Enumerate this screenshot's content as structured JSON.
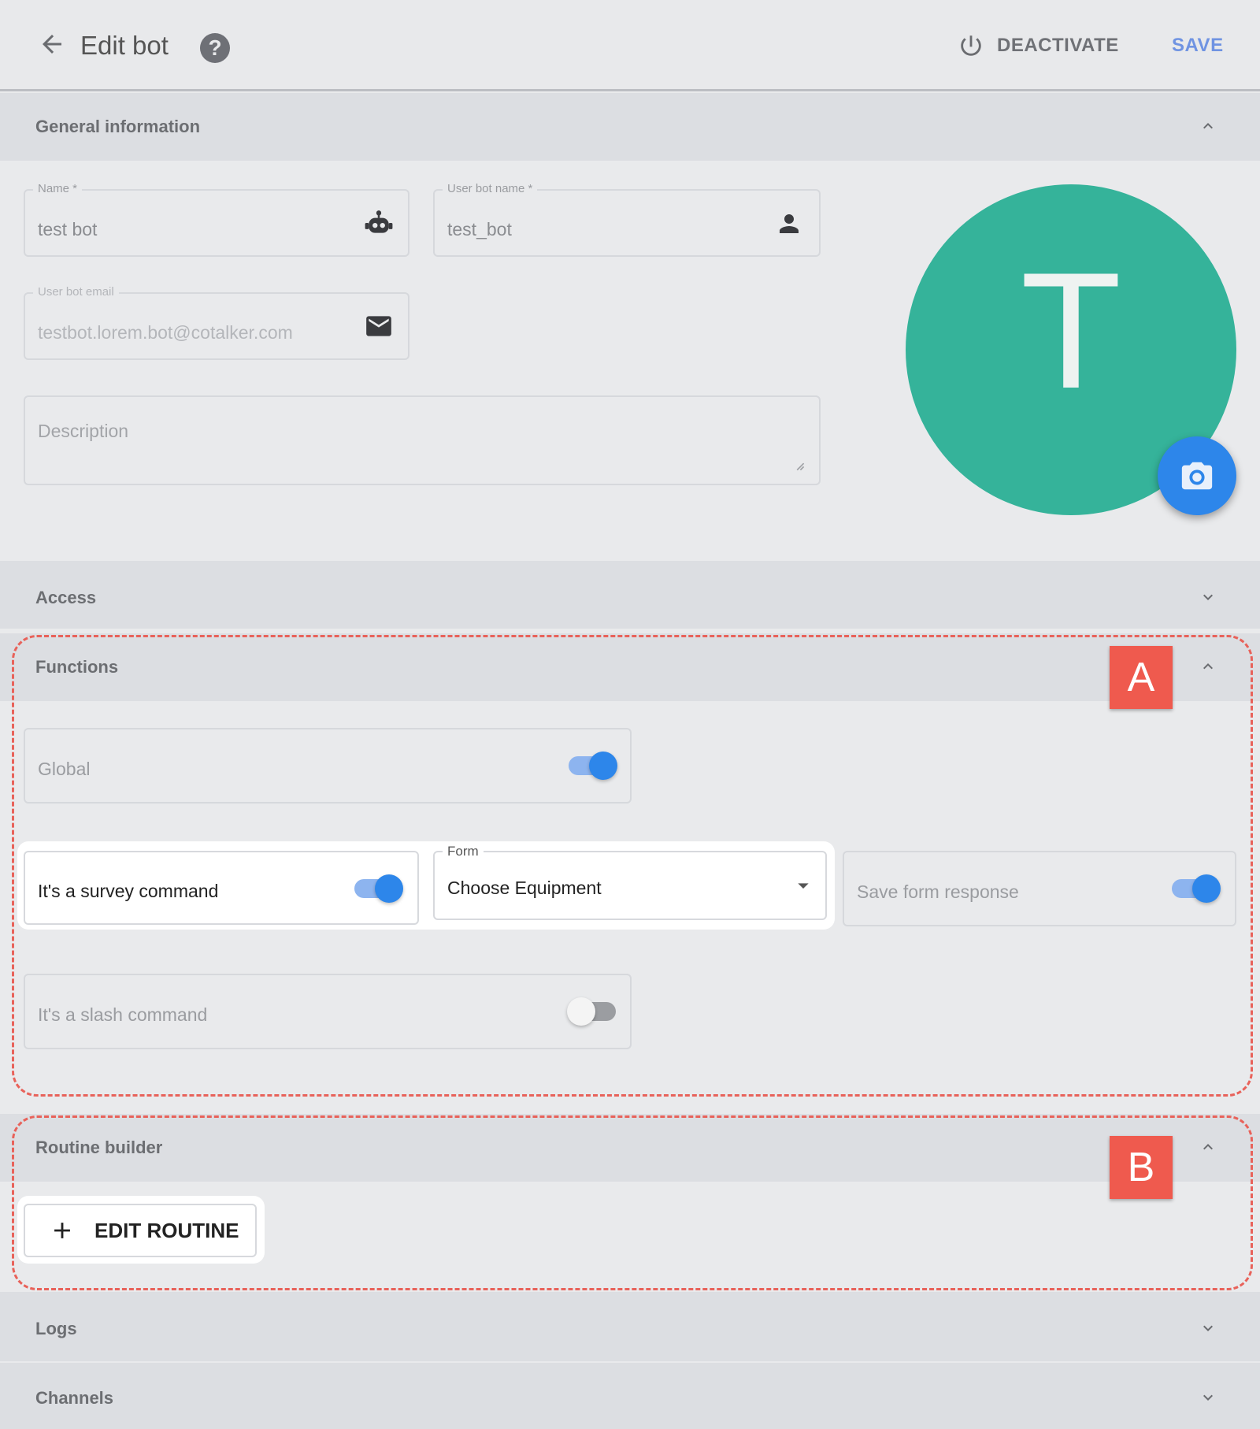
{
  "header": {
    "title": "Edit bot",
    "deactivate_label": "DEACTIVATE",
    "save_label": "SAVE"
  },
  "sections": {
    "general": "General information",
    "access": "Access",
    "functions": "Functions",
    "routine": "Routine builder",
    "logs": "Logs",
    "channels": "Channels"
  },
  "general": {
    "name_label": "Name *",
    "name_value": "test bot",
    "user_bot_name_label": "User bot name *",
    "user_bot_name_value": "test_bot",
    "email_label": "User bot email",
    "email_value": "testbot.lorem.bot@cotalker.com",
    "description_placeholder": "Description",
    "avatar_letter": "T",
    "avatar_color": "#35b39a"
  },
  "functions": {
    "global_label": "Global",
    "global_on": true,
    "survey_label": "It's a survey command",
    "survey_on": true,
    "form_label": "Form",
    "form_value": "Choose Equipment",
    "save_response_label": "Save form response",
    "save_response_on": true,
    "slash_label": "It's a slash command",
    "slash_on": false
  },
  "routine": {
    "edit_label": "EDIT ROUTINE"
  },
  "annotations": {
    "a": "A",
    "b": "B"
  },
  "colors": {
    "accent": "#2d86ea",
    "annotation": "#ef5a4e"
  }
}
